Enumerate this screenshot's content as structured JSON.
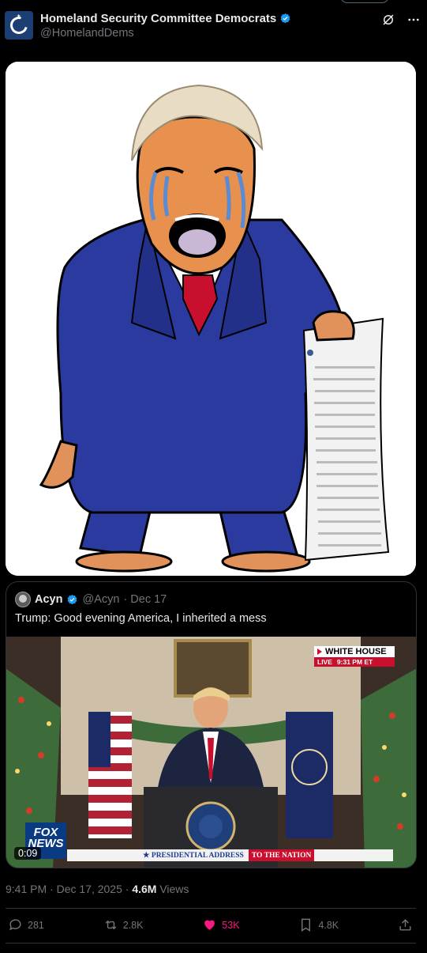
{
  "post": {
    "display_name": "Homeland Security Committee Democrats",
    "handle": "@HomelandDems",
    "timestamp": "9:41 PM · Dec 17, 2025 · ",
    "views_count": "4.6M",
    "views_label": " Views"
  },
  "quote": {
    "name": "Acyn",
    "handle": "@Acyn",
    "date": "· Dec 17",
    "text": "Trump: Good evening America, I inherited a mess",
    "video_duration": "0:09",
    "overlay": {
      "live_title": "WHITE HOUSE",
      "live_tag": "LIVE",
      "live_time": "9:31 PM ET",
      "lower_third_1": "★ PRESIDENTIAL ADDRESS",
      "lower_third_2": "TO THE NATION",
      "network_logo": "FOX NEWS"
    }
  },
  "actions": {
    "replies": "281",
    "reposts": "2.8K",
    "likes": "53K",
    "bookmarks": "4.8K"
  },
  "colors": {
    "background": "#000000",
    "accent_like": "#f91880",
    "verified": "#1d9bf0",
    "muted": "#71767b"
  }
}
